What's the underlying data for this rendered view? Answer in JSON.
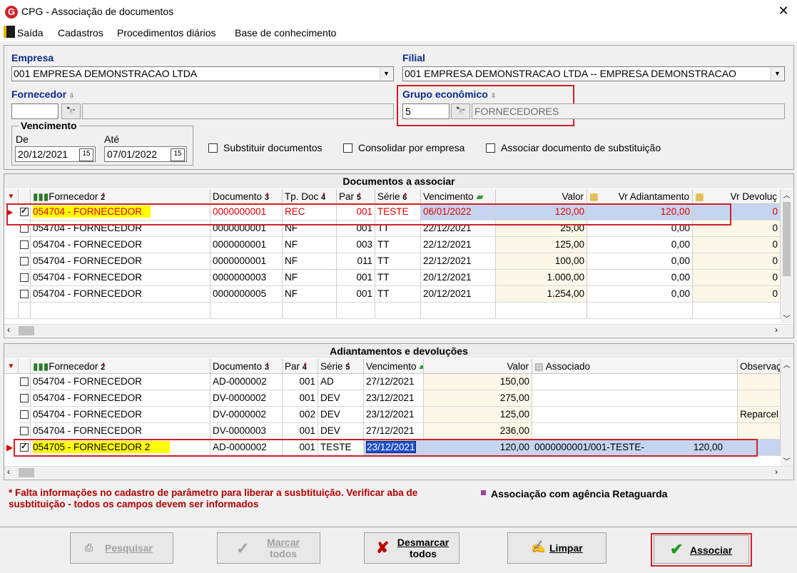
{
  "window": {
    "title": "CPG - Associação de documentos",
    "close": "✕"
  },
  "menu": {
    "items": [
      "Saída",
      "Cadastros",
      "Procedimentos diários",
      "Base de conhecimento"
    ]
  },
  "filters": {
    "empresa_label": "Empresa",
    "empresa_value": "001 EMPRESA DEMONSTRACAO LTDA",
    "filial_label": "Filial",
    "filial_value": "001 EMPRESA DEMONSTRACAO LTDA -- EMPRESA DEMONSTRACAO",
    "fornecedor_label": "Fornecedor",
    "fornecedor_code": "",
    "fornecedor_name": "",
    "grupo_label": "Grupo econômico",
    "grupo_code": "5",
    "grupo_name": "FORNECEDORES",
    "vencimento_label": "Vencimento",
    "de_label": "De",
    "de_value": "20/12/2021",
    "ate_label": "Até",
    "ate_value": "07/01/2022",
    "calendar_icon_text": "15",
    "substituir_label": "Substituir documentos",
    "consolidar_label": "Consolidar por empresa",
    "associar_sub_label": "Associar documento de substituição"
  },
  "documentos": {
    "title": "Documentos a associar",
    "headers": {
      "fornecedor": "Fornecedor",
      "fornecedor_sort": "2",
      "documento": "Documento",
      "documento_sort": "3",
      "tpdoc": "Tp. Doc",
      "tpdoc_sort": "4",
      "par": "Par",
      "par_sort": "5",
      "serie": "Série",
      "serie_sort": "6",
      "vencimento": "Vencimento",
      "valor": "Valor",
      "vr_adiantamento": "Vr Adiantamento",
      "vr_devolucao": "Vr Devoluç"
    },
    "rows": [
      {
        "checked": true,
        "fornecedor": "054704 - FORNECEDOR",
        "documento": "0000000001",
        "tpdoc": "REC",
        "par": "001",
        "serie": "TESTE",
        "vencimento": "06/01/2022",
        "valor": "120,00",
        "vr_adiantamento": "120,00",
        "vr_devolucao": "0"
      },
      {
        "checked": false,
        "fornecedor": "054704 - FORNECEDOR",
        "documento": "0000000001",
        "tpdoc": "NF",
        "par": "001",
        "serie": "TT",
        "vencimento": "22/12/2021",
        "valor": "25,00",
        "vr_adiantamento": "0,00",
        "vr_devolucao": "0"
      },
      {
        "checked": false,
        "fornecedor": "054704 - FORNECEDOR",
        "documento": "0000000001",
        "tpdoc": "NF",
        "par": "003",
        "serie": "TT",
        "vencimento": "22/12/2021",
        "valor": "125,00",
        "vr_adiantamento": "0,00",
        "vr_devolucao": "0"
      },
      {
        "checked": false,
        "fornecedor": "054704 - FORNECEDOR",
        "documento": "0000000001",
        "tpdoc": "NF",
        "par": "011",
        "serie": "TT",
        "vencimento": "22/12/2021",
        "valor": "100,00",
        "vr_adiantamento": "0,00",
        "vr_devolucao": "0"
      },
      {
        "checked": false,
        "fornecedor": "054704 - FORNECEDOR",
        "documento": "0000000003",
        "tpdoc": "NF",
        "par": "001",
        "serie": "TT",
        "vencimento": "20/12/2021",
        "valor": "1.000,00",
        "vr_adiantamento": "0,00",
        "vr_devolucao": "0"
      },
      {
        "checked": false,
        "fornecedor": "054704 - FORNECEDOR",
        "documento": "0000000005",
        "tpdoc": "NF",
        "par": "001",
        "serie": "TT",
        "vencimento": "20/12/2021",
        "valor": "1.254,00",
        "vr_adiantamento": "0,00",
        "vr_devolucao": "0"
      }
    ]
  },
  "adiantamentos": {
    "title": "Adiantamentos e devoluções",
    "headers": {
      "fornecedor": "Fornecedor",
      "fornecedor_sort": "2",
      "documento": "Documento",
      "documento_sort": "3",
      "par": "Par",
      "par_sort": "4",
      "serie": "Série",
      "serie_sort": "5",
      "vencimento": "Vencimento",
      "valor": "Valor",
      "associado": "Associado",
      "observacao": "Observaç"
    },
    "rows": [
      {
        "checked": false,
        "fornecedor": "054704 - FORNECEDOR",
        "documento": "AD-0000002",
        "par": "001",
        "serie": "AD",
        "vencimento": "27/12/2021",
        "valor": "150,00",
        "associado": "",
        "assoc_valor": "",
        "observacao": ""
      },
      {
        "checked": false,
        "fornecedor": "054704 - FORNECEDOR",
        "documento": "DV-0000002",
        "par": "001",
        "serie": "DEV",
        "vencimento": "23/12/2021",
        "valor": "275,00",
        "associado": "",
        "assoc_valor": "",
        "observacao": ""
      },
      {
        "checked": false,
        "fornecedor": "054704 - FORNECEDOR",
        "documento": "DV-0000002",
        "par": "002",
        "serie": "DEV",
        "vencimento": "23/12/2021",
        "valor": "125,00",
        "associado": "",
        "assoc_valor": "",
        "observacao": "Reparcel"
      },
      {
        "checked": false,
        "fornecedor": "054704 - FORNECEDOR",
        "documento": "DV-0000003",
        "par": "001",
        "serie": "DEV",
        "vencimento": "27/12/2021",
        "valor": "236,00",
        "associado": "",
        "assoc_valor": "",
        "observacao": ""
      },
      {
        "checked": true,
        "fornecedor": "054705 - FORNECEDOR 2",
        "documento": "AD-0000002",
        "par": "001",
        "serie": "TESTE",
        "vencimento": "23/12/2021",
        "valor": "120,00",
        "associado": "0000000001/001-TESTE-",
        "assoc_valor": "120,00",
        "observacao": ""
      }
    ]
  },
  "notes": {
    "warning": "* Falta informações no cadastro de parâmetro para liberar a susbtituição. Verificar aba de susbtituição - todos os campos devem ser informados",
    "legend": "Associação com agência Retaguarda"
  },
  "buttons": {
    "pesquisar": "Pesquisar",
    "marcar_todos_1": "Marcar",
    "marcar_todos_2": "todos",
    "desmarcar_1": "Desmarcar",
    "desmarcar_2": "todos",
    "limpar": "Limpar",
    "associar": "Associar"
  },
  "colors": {
    "accent_red": "#d0202a",
    "selection_blue": "#c5d5ef",
    "highlight_yellow": "#ffff00",
    "label_blue": "#0a2a8a"
  }
}
